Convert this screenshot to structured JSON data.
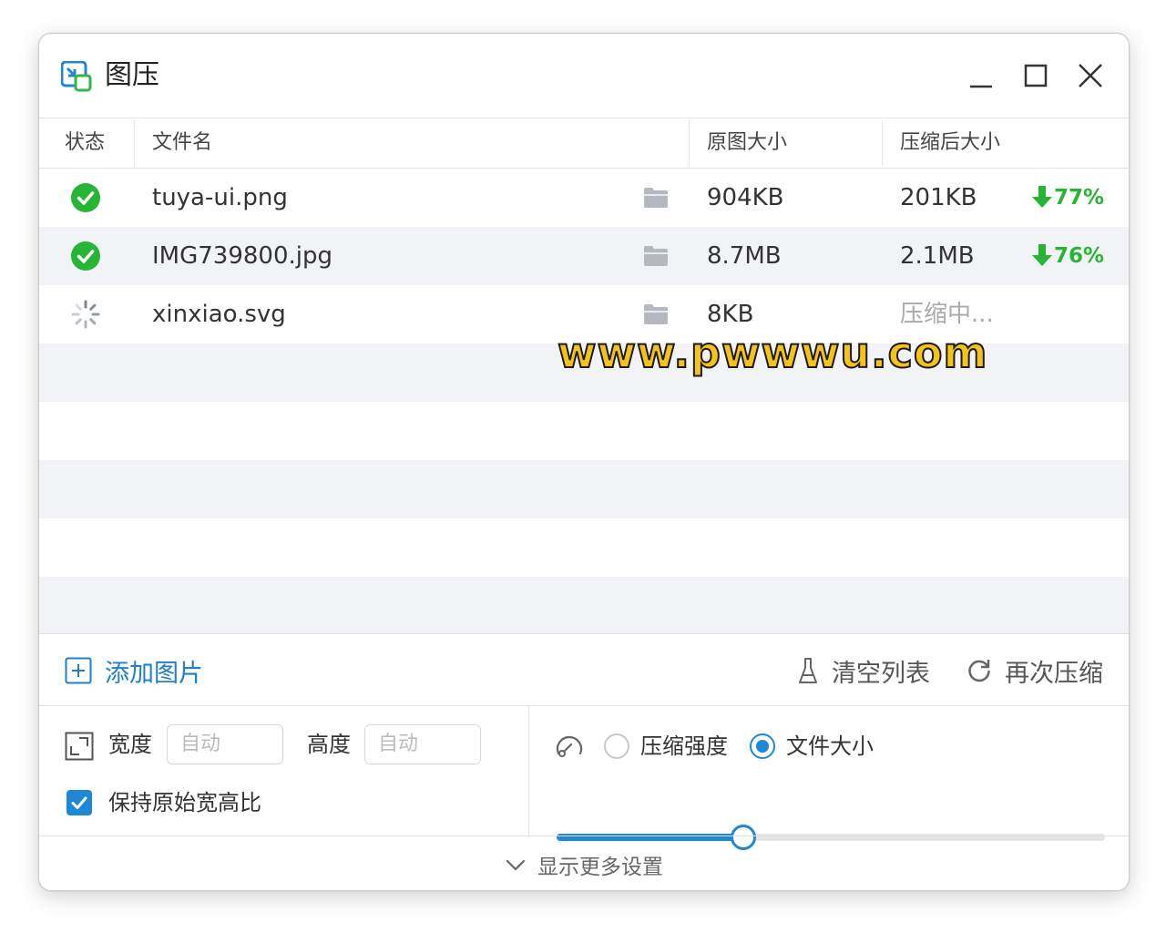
{
  "window": {
    "title": "图压"
  },
  "table": {
    "headers": {
      "status": "状态",
      "filename": "文件名",
      "original": "原图大小",
      "compressed": "压缩后大小"
    },
    "rows": [
      {
        "status": "done",
        "status_icon": "check-circle-icon",
        "filename": "tuya-ui.png",
        "original": "904KB",
        "compressed": "201KB",
        "ratio": "77%"
      },
      {
        "status": "done",
        "status_icon": "check-circle-icon",
        "filename": "IMG739800.jpg",
        "original": "8.7MB",
        "compressed": "2.1MB",
        "ratio": "76%"
      },
      {
        "status": "processing",
        "status_icon": "loading-spinner-icon",
        "filename": "xinxiao.svg",
        "original": "8KB",
        "compressed": "压缩中..."
      }
    ]
  },
  "actions": {
    "add_label": "添加图片",
    "clear_label": "清空列表",
    "recompress_label": "再次压缩"
  },
  "settings": {
    "width_label": "宽度",
    "width_placeholder": "自动",
    "height_label": "高度",
    "height_placeholder": "自动",
    "keep_ratio_label": "保持原始宽高比",
    "keep_ratio_checked": true,
    "mode_options": [
      "压缩强度",
      "文件大小"
    ],
    "mode_selected": "文件大小",
    "slider_value": 0.34
  },
  "footer": {
    "more_label": "显示更多设置"
  },
  "watermark": "www.pwwwu.com",
  "colors": {
    "accent": "#1e88d6",
    "success": "#27b535"
  }
}
